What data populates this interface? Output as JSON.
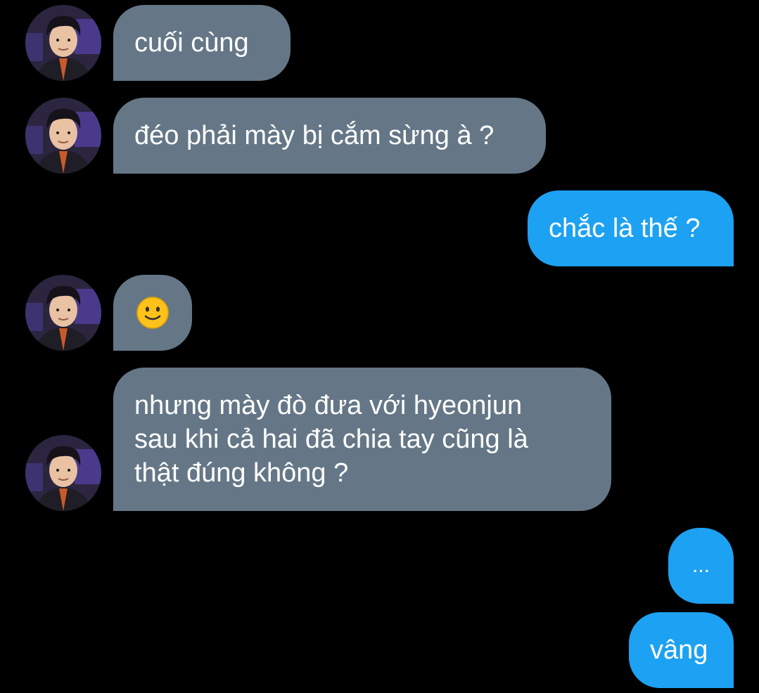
{
  "colors": {
    "background": "#000000",
    "incoming_bubble": "#657786",
    "outgoing_bubble": "#1da1f2",
    "text": "#ffffff"
  },
  "messages": [
    {
      "sender": "other",
      "text": "cuối cùng",
      "avatar": "profile-photo"
    },
    {
      "sender": "other",
      "text": "đéo phải mày bị cắm sừng à ?",
      "avatar": "profile-photo"
    },
    {
      "sender": "self",
      "text": "chắc là thế ?"
    },
    {
      "sender": "other",
      "emoji": "slightly-smiling-face-icon",
      "avatar": "profile-photo"
    },
    {
      "sender": "other",
      "text": "nhưng mày đò đưa với hyeonjun\nsau khi cả hai đã chia tay cũng là\nthật đúng không ?",
      "avatar": "profile-photo"
    },
    {
      "sender": "self",
      "text": "..."
    },
    {
      "sender": "self",
      "text": "vâng"
    }
  ]
}
